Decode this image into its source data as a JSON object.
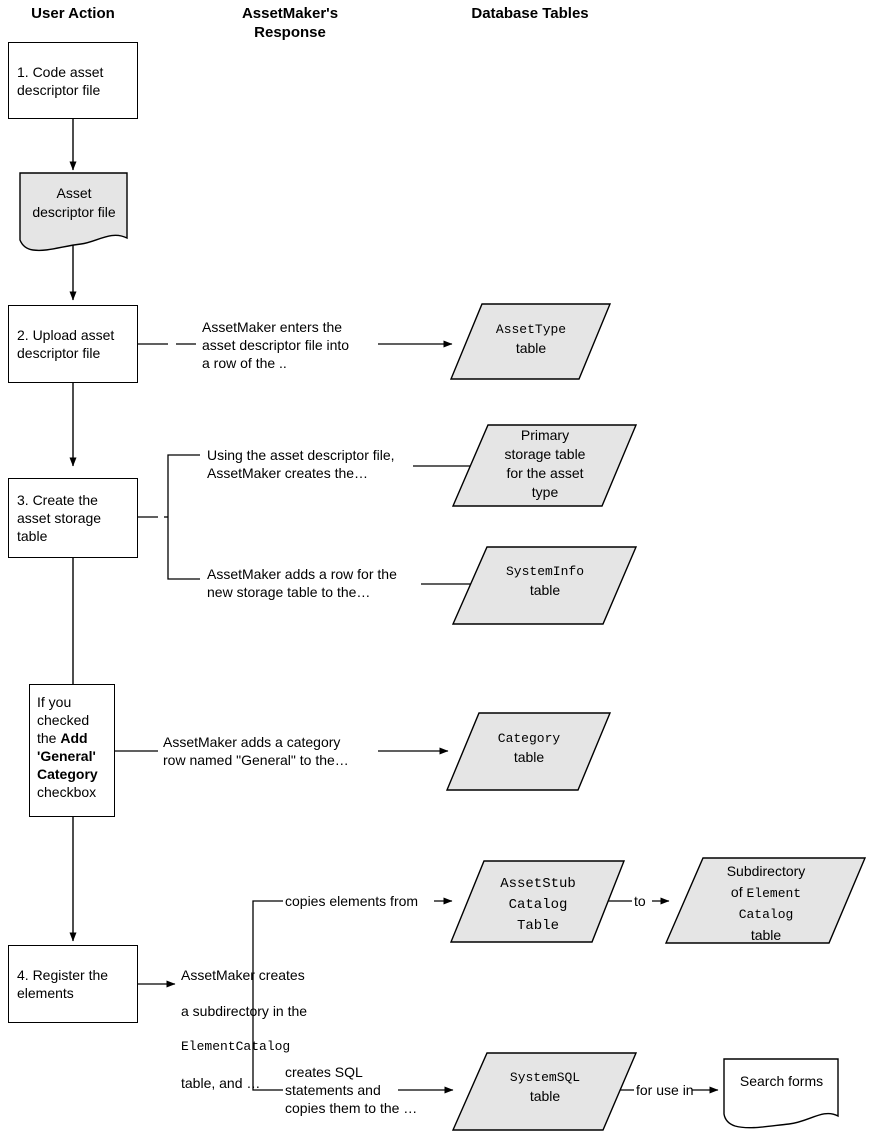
{
  "columns": [
    {
      "id": "user-action",
      "label": "User Action"
    },
    {
      "id": "assetmaker-response",
      "label": "AssetMaker's\nResponse"
    },
    {
      "id": "database-tables",
      "label": "Database Tables"
    }
  ],
  "steps": [
    {
      "id": "step-1",
      "label": "1. Code asset descriptor file"
    },
    {
      "id": "step-2",
      "label": "2. Upload asset descriptor file"
    },
    {
      "id": "step-3",
      "label": "3. Create the asset storage table"
    },
    {
      "id": "step-4",
      "label": "4. Register the elements"
    }
  ],
  "conditional_box": {
    "line1": "If you",
    "line2": "checked",
    "line3_plain": "the ",
    "line3_bold": "Add",
    "line4_bold": "'General'",
    "line5_bold": "Category",
    "line6": "checkbox"
  },
  "documents": [
    {
      "id": "asset-descriptor-file",
      "line1": "Asset",
      "line2": "descriptor file",
      "fill": "#e5e5e5"
    },
    {
      "id": "search-forms",
      "line1": "Search forms",
      "fill": "#ffffff"
    }
  ],
  "notes": [
    {
      "id": "note-assettype",
      "text": "AssetMaker enters the\nasset descriptor file into\na row of the  .."
    },
    {
      "id": "note-primary-storage",
      "text": "Using the asset descriptor file,\nAssetMaker creates the…"
    },
    {
      "id": "note-systeminfo",
      "text": "AssetMaker adds a row for the\nnew storage table to the…"
    },
    {
      "id": "note-category",
      "text": "AssetMaker adds a category\nrow named \"General\" to the…"
    },
    {
      "id": "note-copies-elements",
      "text": "copies elements from"
    },
    {
      "id": "note-to",
      "text": "to"
    },
    {
      "id": "note-creates-sql",
      "text": "creates SQL\nstatements and\ncopies them to the …"
    },
    {
      "id": "note-for-use-in",
      "text": "for  use in"
    }
  ],
  "note_register": {
    "line1": "AssetMaker creates",
    "line2": "a subdirectory in the",
    "line3_mono": "ElementCatalog",
    "line4": "table, and …"
  },
  "tables": [
    {
      "id": "assettype-table",
      "name_mono": "AssetType",
      "suffix": "table",
      "fill": "#e5e5e5"
    },
    {
      "id": "primary-storage-table",
      "lines": [
        "Primary",
        "storage table",
        "for the asset",
        "type"
      ],
      "fill": "#e5e5e5"
    },
    {
      "id": "systeminfo-table",
      "name_mono": "SystemInfo",
      "suffix": "table",
      "fill": "#e5e5e5"
    },
    {
      "id": "category-table",
      "name_mono": "Category",
      "suffix": "table",
      "fill": "#e5e5e5"
    },
    {
      "id": "assetstub-catalog-table",
      "mono_lines": [
        "AssetStub",
        "Catalog",
        "Table"
      ],
      "fill": "#e5e5e5"
    },
    {
      "id": "subdirectory-element-catalog-table",
      "line1": "Subdirectory",
      "line2_plain": "of ",
      "line2_mono": "Element",
      "line3_mono": "Catalog",
      "line4": "table",
      "fill": "#e5e5e5"
    },
    {
      "id": "systemsql-table",
      "name_mono": "SystemSQL",
      "suffix": "table",
      "fill": "#e5e5e5"
    }
  ],
  "colors": {
    "shape_fill": "#e5e5e5",
    "stroke": "#000000",
    "background": "#ffffff"
  }
}
